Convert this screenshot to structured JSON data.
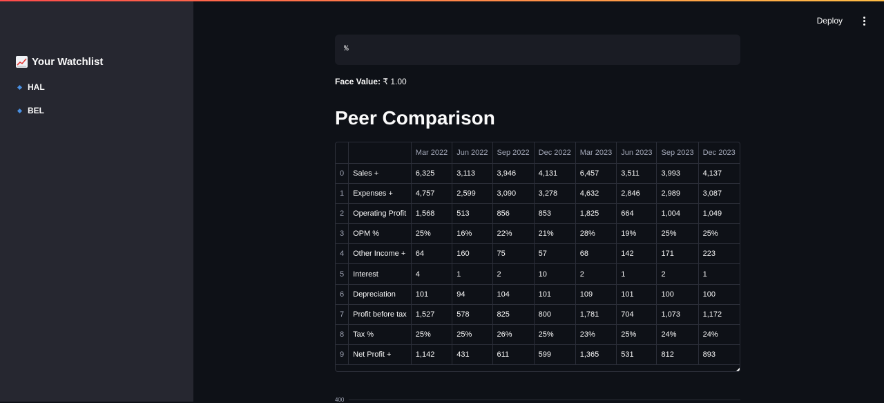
{
  "sidebar": {
    "title": "Your Watchlist",
    "items": [
      {
        "label": "HAL"
      },
      {
        "label": "BEL"
      }
    ]
  },
  "header": {
    "deploy_label": "Deploy"
  },
  "main": {
    "code_text": "%",
    "face_value_label": "Face Value:",
    "face_value": "₹ 1.00",
    "title": "Peer Comparison",
    "chart_hint": "400"
  },
  "table": {
    "columns": [
      "Mar 2022",
      "Jun 2022",
      "Sep 2022",
      "Dec 2022",
      "Mar 2023",
      "Jun 2023",
      "Sep 2023",
      "Dec 2023"
    ],
    "rows": [
      {
        "index": "0",
        "label": "Sales +",
        "values": [
          "6,325",
          "3,113",
          "3,946",
          "4,131",
          "6,457",
          "3,511",
          "3,993",
          "4,137"
        ]
      },
      {
        "index": "1",
        "label": "Expenses +",
        "values": [
          "4,757",
          "2,599",
          "3,090",
          "3,278",
          "4,632",
          "2,846",
          "2,989",
          "3,087"
        ]
      },
      {
        "index": "2",
        "label": "Operating Profit",
        "values": [
          "1,568",
          "513",
          "856",
          "853",
          "1,825",
          "664",
          "1,004",
          "1,049"
        ]
      },
      {
        "index": "3",
        "label": "OPM %",
        "values": [
          "25%",
          "16%",
          "22%",
          "21%",
          "28%",
          "19%",
          "25%",
          "25%"
        ]
      },
      {
        "index": "4",
        "label": "Other Income +",
        "values": [
          "64",
          "160",
          "75",
          "57",
          "68",
          "142",
          "171",
          "223"
        ]
      },
      {
        "index": "5",
        "label": "Interest",
        "values": [
          "4",
          "1",
          "2",
          "10",
          "2",
          "1",
          "2",
          "1"
        ]
      },
      {
        "index": "6",
        "label": "Depreciation",
        "values": [
          "101",
          "94",
          "104",
          "101",
          "109",
          "101",
          "100",
          "100"
        ]
      },
      {
        "index": "7",
        "label": "Profit before tax",
        "values": [
          "1,527",
          "578",
          "825",
          "800",
          "1,781",
          "704",
          "1,073",
          "1,172"
        ]
      },
      {
        "index": "8",
        "label": "Tax %",
        "values": [
          "25%",
          "25%",
          "26%",
          "25%",
          "23%",
          "25%",
          "24%",
          "24%"
        ]
      },
      {
        "index": "9",
        "label": "Net Profit +",
        "values": [
          "1,142",
          "431",
          "611",
          "599",
          "1,365",
          "531",
          "812",
          "893"
        ]
      }
    ]
  },
  "colors": {
    "background": "#0e1117",
    "sidebar": "#262730",
    "accent_start": "#ff4b4b",
    "accent_end": "#ffbd45",
    "bullet": "#4a90e2"
  }
}
